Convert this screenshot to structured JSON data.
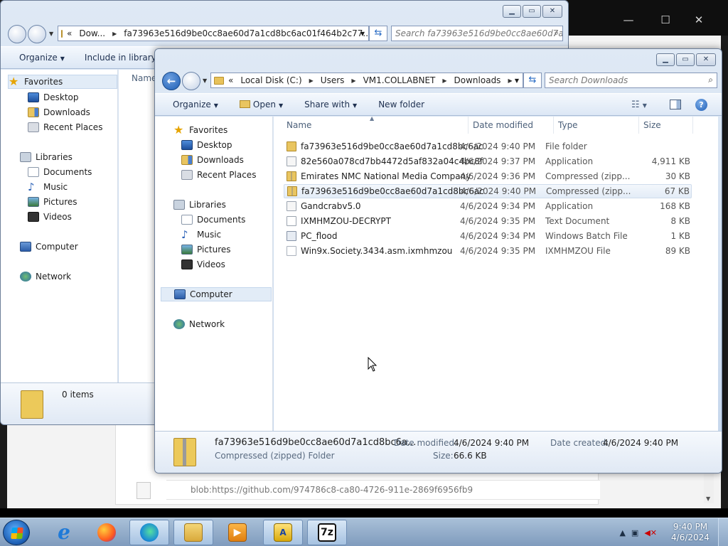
{
  "background_browser": {
    "blob_url": "blob:https://github.com/974786c8-ca80-4726-911e-2869f6956fb9"
  },
  "window_back": {
    "address_segments": [
      "Dow...",
      "fa73963e516d9be0cc8ae60d7a1cd8bc6ac01f464b2c77..."
    ],
    "address_prefix": "«",
    "search_placeholder": "Search fa73963e516d9be0cc8ae60d7a...",
    "commands": [
      "Organize",
      "Include in library"
    ],
    "column_name": "Name",
    "nav": {
      "favorites": "Favorites",
      "desktop": "Desktop",
      "downloads": "Downloads",
      "recent": "Recent Places",
      "libraries": "Libraries",
      "documents": "Documents",
      "music": "Music",
      "pictures": "Pictures",
      "videos": "Videos",
      "computer": "Computer",
      "network": "Network"
    },
    "status_items": "0 items"
  },
  "window_front": {
    "address_prefix": "«",
    "address_segments": [
      "Local Disk (C:)",
      "Users",
      "VM1.COLLABNET",
      "Downloads"
    ],
    "search_placeholder": "Search Downloads",
    "commands": {
      "organize": "Organize",
      "open": "Open",
      "share": "Share with",
      "new_folder": "New folder"
    },
    "nav": {
      "favorites": "Favorites",
      "desktop": "Desktop",
      "downloads": "Downloads",
      "recent": "Recent Places",
      "libraries": "Libraries",
      "documents": "Documents",
      "music": "Music",
      "pictures": "Pictures",
      "videos": "Videos",
      "computer": "Computer",
      "network": "Network"
    },
    "columns": {
      "name": "Name",
      "date": "Date modified",
      "type": "Type",
      "size": "Size"
    },
    "files": [
      {
        "name": "fa73963e516d9be0cc8ae60d7a1cd8bc6ac...",
        "date": "4/6/2024 9:40 PM",
        "type": "File folder",
        "size": "",
        "icon": "folder"
      },
      {
        "name": "82e560a078cd7bb4472d5af832a04c4bc8f1...",
        "date": "4/6/2024 9:37 PM",
        "type": "Application",
        "size": "4,911 KB",
        "icon": "app"
      },
      {
        "name": "Emirates NMC National Media Company",
        "date": "4/6/2024 9:36 PM",
        "type": "Compressed (zipp...",
        "size": "30 KB",
        "icon": "zip"
      },
      {
        "name": "fa73963e516d9be0cc8ae60d7a1cd8bc6ac...",
        "date": "4/6/2024 9:40 PM",
        "type": "Compressed (zipp...",
        "size": "67 KB",
        "icon": "zip",
        "selected": true
      },
      {
        "name": "Gandcrabv5.0",
        "date": "4/6/2024 9:34 PM",
        "type": "Application",
        "size": "168 KB",
        "icon": "app"
      },
      {
        "name": "IXMHMZOU-DECRYPT",
        "date": "4/6/2024 9:35 PM",
        "type": "Text Document",
        "size": "8 KB",
        "icon": "txt"
      },
      {
        "name": "PC_flood",
        "date": "4/6/2024 9:34 PM",
        "type": "Windows Batch File",
        "size": "1 KB",
        "icon": "bat"
      },
      {
        "name": "Win9x.Society.3434.asm.ixmhmzou",
        "date": "4/6/2024 9:35 PM",
        "type": "IXMHMZOU File",
        "size": "89 KB",
        "icon": "gen"
      }
    ],
    "details": {
      "name": "fa73963e516d9be0cc8ae60d7a1cd8bc6a...",
      "type": "Compressed (zipped) Folder",
      "date_modified_label": "Date modified:",
      "date_modified": "4/6/2024 9:40 PM",
      "size_label": "Size:",
      "size": "66.6 KB",
      "date_created_label": "Date created:",
      "date_created": "4/6/2024 9:40 PM"
    }
  },
  "taskbar": {
    "time": "9:40 PM",
    "date": "4/6/2024",
    "sevenzip_label": "7z"
  },
  "colors": {
    "taskbar": "#8fa9c8",
    "selection": "#e3ecf7",
    "window_frame": "#c5d6ec"
  }
}
